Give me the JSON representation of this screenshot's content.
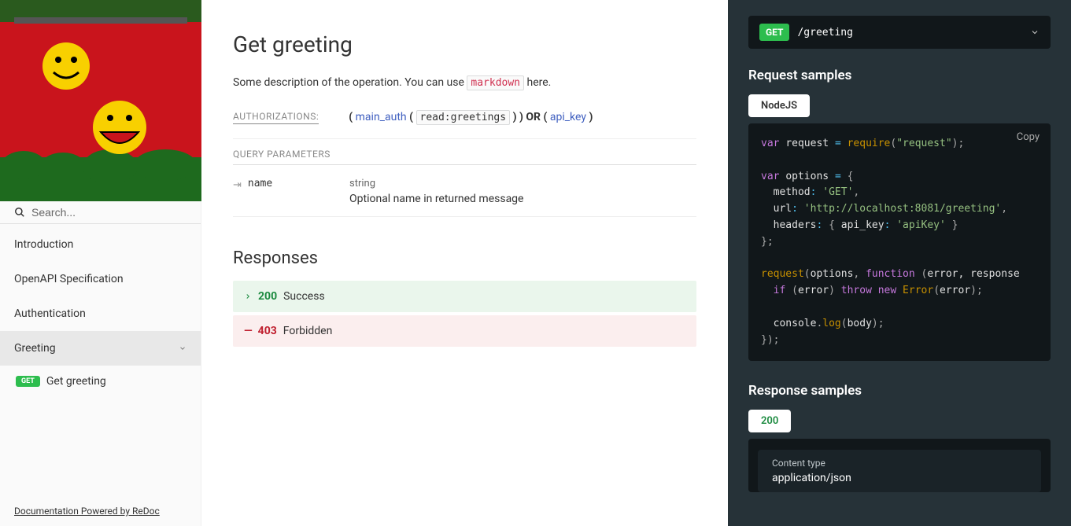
{
  "sidebar": {
    "search_placeholder": "Search...",
    "items": [
      {
        "label": "Introduction"
      },
      {
        "label": "OpenAPI Specification"
      },
      {
        "label": "Authentication"
      },
      {
        "label": "Greeting",
        "active": true,
        "expandable": true
      }
    ],
    "sub": {
      "method": "GET",
      "label": "Get greeting"
    },
    "footer": "Documentation Powered by ReDoc"
  },
  "main": {
    "title": "Get greeting",
    "desc_pre": "Some description of the operation. You can use ",
    "desc_code": "markdown",
    "desc_post": " here.",
    "auth_label": "AUTHORIZATIONS:",
    "auth": {
      "open1": "(",
      "link1": "main_auth",
      "open2": "(",
      "scope": "read:greetings",
      "close2": ") )",
      "or": "OR",
      "open3": "(",
      "link2": "api_key",
      "close3": ")"
    },
    "qp_label": "QUERY PARAMETERS",
    "param": {
      "name": "name",
      "type": "string",
      "desc": "Optional name in returned message"
    },
    "responses_title": "Responses",
    "resp200": {
      "code": "200",
      "text": "Success"
    },
    "resp403": {
      "code": "403",
      "text": "Forbidden"
    }
  },
  "right": {
    "endpoint": {
      "method": "GET",
      "path": "/greeting"
    },
    "req_title": "Request samples",
    "req_tab": "NodeJS",
    "copy": "Copy",
    "code": {
      "l1_var": "var",
      "l1_req": "request",
      "l1_eq": "=",
      "l1_fn": "require",
      "l1_op": "(",
      "l1_str": "\"request\"",
      "l1_cl": ");",
      "l2_var": "var",
      "l2_opt": "options",
      "l2_eq": "=",
      "l2_brace": "{",
      "l3_k": "method",
      "l3_c": ":",
      "l3_v": "'GET'",
      "l3_comma": ",",
      "l4_k": "url",
      "l4_c": ":",
      "l4_v": "'http://localhost:8081/greeting'",
      "l4_comma": ",",
      "l5_k": "headers",
      "l5_c": ":",
      "l5_ob": "{",
      "l5_hk": "api_key",
      "l5_hc": ":",
      "l5_hv": "'apiKey'",
      "l5_cb": "}",
      "l6": "};",
      "l7_fn": "request",
      "l7_op": "(",
      "l7_a1": "options",
      "l7_comma": ",",
      "l7_func": "function",
      "l7_op2": "(",
      "l7_p": "error, response",
      "l8_if": "if",
      "l8_op": "(",
      "l8_err": "error",
      "l8_cl": ")",
      "l8_throw": "throw",
      "l8_new": "new",
      "l8_Err": "Error",
      "l8_op2": "(",
      "l8_err2": "error",
      "l8_end": ");",
      "l9_con": "console",
      "l9_dot": ".",
      "l9_log": "log",
      "l9_op": "(",
      "l9_body": "body",
      "l9_end": ");",
      "l10": "});"
    },
    "resp_title": "Response samples",
    "resp_tab": "200",
    "ct_label": "Content type",
    "ct_value": "application/json"
  }
}
